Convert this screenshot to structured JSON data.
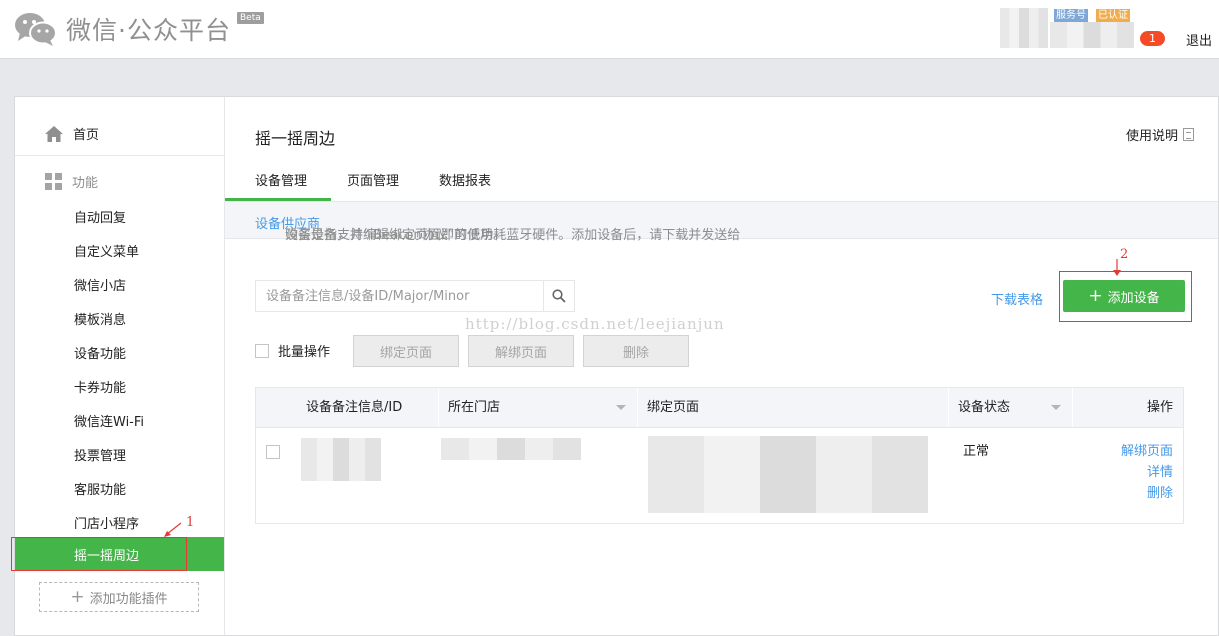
{
  "header": {
    "logo_text": "微信·公众平台",
    "beta": "Beta",
    "badge_service": "服务号",
    "badge_certified": "已认证",
    "notice_count": "1",
    "logout": "退出"
  },
  "sidebar": {
    "home": "首页",
    "section": "功能",
    "items": [
      "自动回复",
      "自定义菜单",
      "微信小店",
      "模板消息",
      "设备功能",
      "卡券功能",
      "微信连Wi-Fi",
      "投票管理",
      "客服功能",
      "门店小程序"
    ],
    "active": "摇一摇周边",
    "add_plugin": "添加功能插件"
  },
  "annotations": {
    "a1": "1",
    "a2": "2"
  },
  "main": {
    "title": "摇一摇周边",
    "help": "使用说明",
    "tabs": [
      "设备管理",
      "页面管理",
      "数据报表"
    ],
    "info": {
      "before": "设备是指支持“iBeacon协议”的低功耗蓝牙硬件。添加设备后，请下载并发送给",
      "link": "设备供应商",
      "after": "购买设备，并编辑绑定页面即可使用。"
    },
    "search_placeholder": "设备备注信息/设备ID/Major/Minor",
    "download": "下载表格",
    "add_device": "添加设备",
    "batch": "批量操作",
    "btn_bind": "绑定页面",
    "btn_unbind": "解绑页面",
    "btn_delete": "删除",
    "watermark": "http://blog.csdn.net/leejianjun"
  },
  "table": {
    "headers": [
      "设备备注信息/ID",
      "所在门店",
      "绑定页面",
      "设备状态",
      "操作"
    ],
    "rows": [
      {
        "status": "正常",
        "actions": [
          "解绑页面",
          "详情",
          "删除"
        ]
      }
    ]
  },
  "colors": {
    "accent": "#44b549",
    "link": "#459ae9",
    "annotation": "#e53935"
  }
}
